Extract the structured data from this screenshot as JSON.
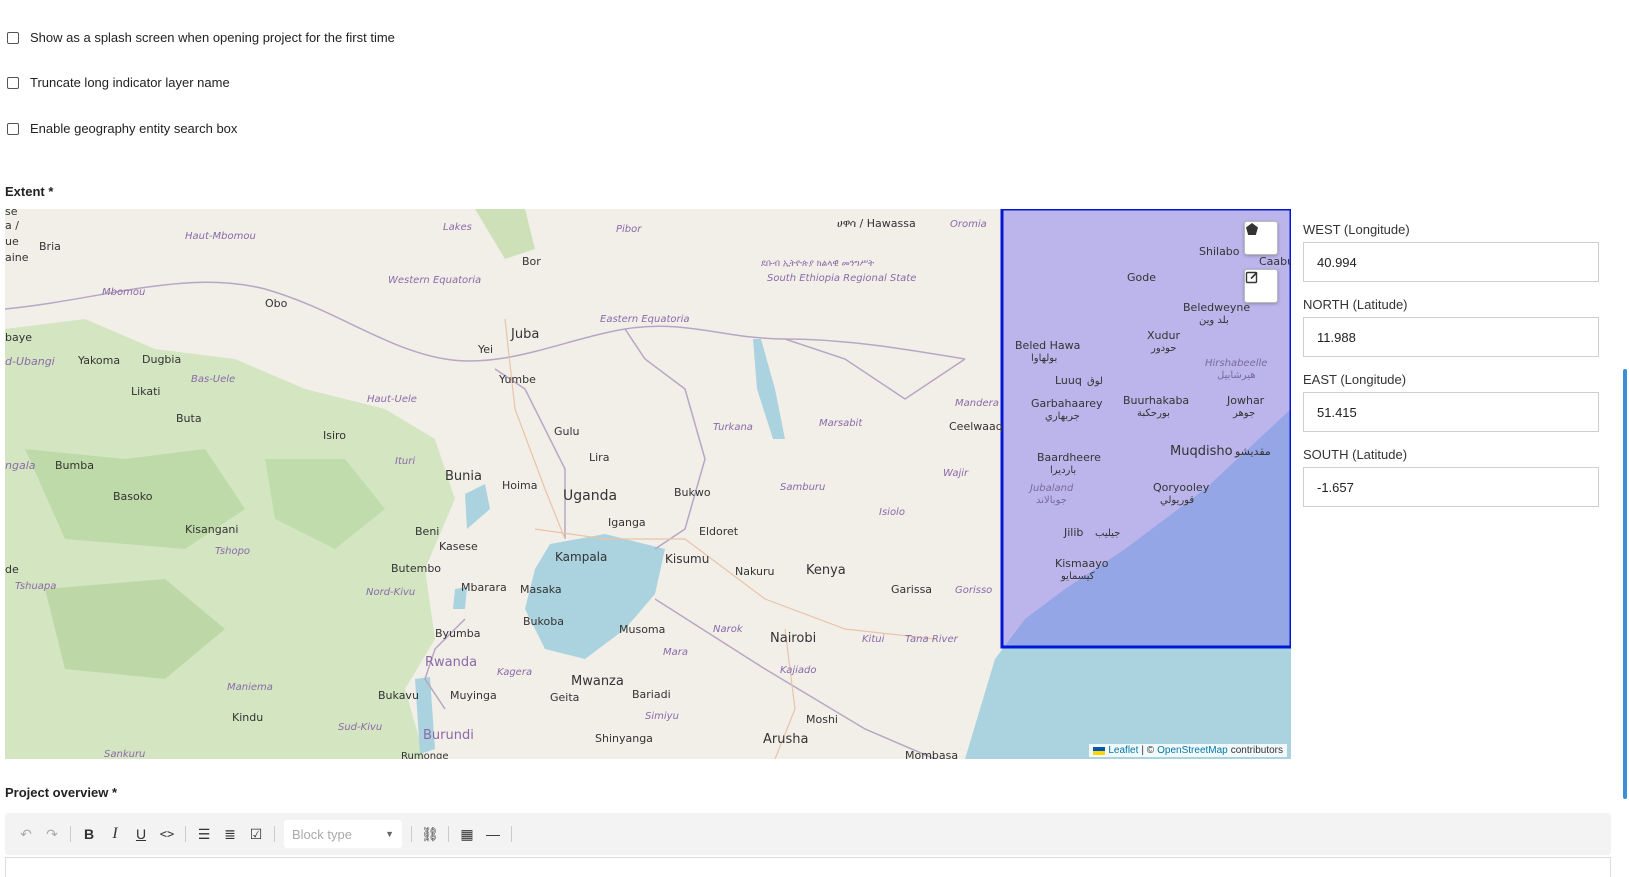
{
  "settings": {
    "checkboxes": [
      {
        "label": "Show as a splash screen when opening project for the first time",
        "checked": false
      },
      {
        "label": "Truncate long indicator layer name",
        "checked": false
      },
      {
        "label": "Enable geography entity search box",
        "checked": false
      }
    ]
  },
  "extent": {
    "label": "Extent *",
    "fields": {
      "west": {
        "label": "WEST (Longitude)",
        "value": "40.994"
      },
      "north": {
        "label": "NORTH (Latitude)",
        "value": "11.988"
      },
      "east": {
        "label": "EAST (Longitude)",
        "value": "51.415"
      },
      "south": {
        "label": "SOUTH (Latitude)",
        "value": "-1.657"
      }
    }
  },
  "map": {
    "attribution": {
      "leaflet": "Leaflet",
      "separator": "| ©",
      "osm": "OpenStreetMap",
      "suffix": "contributors"
    },
    "controls": {
      "polygon_icon": "pentagon-icon",
      "edit_icon": "edit-icon"
    },
    "labels": {
      "juba": "Juba",
      "uganda": "Uganda",
      "kampala": "Kampala",
      "kenya": "Kenya",
      "nairobi": "Nairobi",
      "mogadishu": "Muqdisho",
      "mogadishu_ar": "مقديشو",
      "arusha": "Arusha",
      "mwanza": "Mwanza",
      "kisumu": "Kisumu",
      "bunia": "Bunia",
      "gulu": "Gulu",
      "lira": "Lira",
      "rwanda": "Rwanda",
      "burundi": "Burundi",
      "eldoret": "Eldoret",
      "nakuru": "Nakuru",
      "garissa": "Garissa",
      "kismaayo": "Kismaayo",
      "kismaayo_ar": "كيسمايو",
      "jilib": "Jilib",
      "jilib_ar": "جيليب",
      "qoryooley": "Qoryooley",
      "qoryooley_ar": "قوريولي",
      "baardheere": "Baardheere",
      "baardheere_ar": "بارديرا",
      "luuq": "Luuq",
      "luuq_ar": "لوق",
      "garbahaarey": "Garbahaarey",
      "garbahaarey_ar": "جربهاري",
      "beledhawa": "Beled Hawa",
      "beledhawa_ar": "بولهاوا",
      "buurhakaba": "Buurhakaba",
      "buurhakaba_ar": "بورحكبة",
      "jowhar": "Jowhar",
      "jowhar_ar": "جوهر",
      "xudur": "Xudur",
      "xudur_ar": "حودور",
      "beledweyne": "Beledweyne",
      "beledweyne_ar": "بلد وين",
      "gode": "Gode",
      "shilabo": "Shilabo",
      "caabudwaa": "Caabudwaa",
      "hirshabeelle": "Hirshabeelle",
      "hirshabeelle_ar": "هيرشابيل",
      "jubaland": "Jubaland",
      "jubaland_ar": "جوبالاند",
      "ceelwaaq": "Ceelwaaq",
      "mandera": "Mandera",
      "wajir": "Wajir",
      "marsabit": "Marsabit",
      "turkana": "Turkana",
      "samburu": "Samburu",
      "isiolo": "Isiolo",
      "kitui": "Kitui",
      "tana_river": "Tana River",
      "gorisso": "Gorisso",
      "kajiado": "Kajiado",
      "narok": "Narok",
      "mara": "Mara",
      "moshi": "Moshi",
      "mombasa": "Mombasa",
      "shinyanga": "Shinyanga",
      "simiyu": "Simiyu",
      "geita": "Geita",
      "bariadi": "Bariadi",
      "musoma": "Musoma",
      "bukoba": "Bukoba",
      "kagera": "Kagera",
      "kisangani": "Kisangani",
      "tshopo": "Tshopo",
      "butembo": "Butembo",
      "beni": "Beni",
      "kasese": "Kasese",
      "mbarara": "Mbarara",
      "masaka": "Masaka",
      "byumba": "Byumba",
      "bukavu": "Bukavu",
      "muyinga": "Muyinga",
      "kindu": "Kindu",
      "maniema": "Maniema",
      "sud_kivu": "Sud-Kivu",
      "nord_kivu": "Nord-Kivu",
      "sankuru": "Sankuru",
      "rumonge": "Rumonge",
      "bumba": "Bumba",
      "basoko": "Basoko",
      "buta": "Buta",
      "isiro": "Isiro",
      "ituri": "Ituri",
      "haut_uele": "Haut-Uele",
      "bas_uele": "Bas-Uele",
      "likati": "Likati",
      "yakoma": "Yakoma",
      "dugbia": "Dugbia",
      "bria": "Bria",
      "haut_mbomou": "Haut-Mbomou",
      "mbomou": "Mbomou",
      "obo": "Obo",
      "western_equatoria": "Western Equatoria",
      "eastern_equatoria": "Eastern Equatoria",
      "lakes": "Lakes",
      "pibor": "Pibor",
      "bor": "Bor",
      "yei": "Yei",
      "yumbe": "Yumbe",
      "hoima": "Hoima",
      "iganga": "Iganga",
      "bukwo": "Bukwo",
      "hawassa": "ሀዋሳ / Hawassa",
      "oromia": "Oromia",
      "south_ethiopia": "South Ethiopia Regional State",
      "south_ethiopia_am": "ደቡብ ኢትዮጵያ ክልላዊ መንግሥት",
      "tshuapa": "Tshuapa"
    },
    "edge_labels": [
      "se",
      "a /",
      "ue",
      "aine",
      "baye",
      "d-Ubangi",
      "ngala",
      "de"
    ]
  },
  "overview": {
    "label": "Project overview *"
  },
  "toolbar": {
    "block_type_placeholder": "Block type"
  }
}
